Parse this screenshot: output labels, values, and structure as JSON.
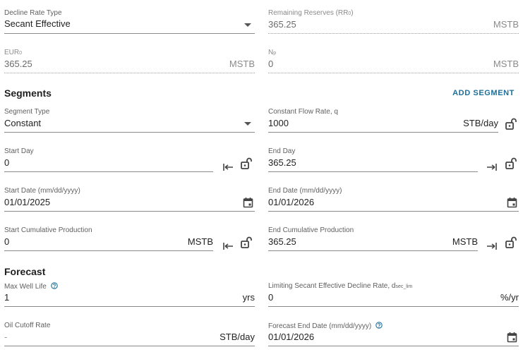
{
  "decline_rate_type": {
    "label": "Decline Rate Type",
    "value": "Secant Effective"
  },
  "remaining_reserves": {
    "label": "Remaining Reserves (RR",
    "label_sub": "0",
    "label_end": ")",
    "value": "365.25",
    "unit": "MSTB"
  },
  "eur": {
    "label": "EUR",
    "label_sub": "0",
    "value": "365.25",
    "unit": "MSTB"
  },
  "np": {
    "label": "N",
    "label_sub": "p",
    "value": "0",
    "unit": "MSTB"
  },
  "segments": {
    "heading": "Segments",
    "add_button": "ADD SEGMENT"
  },
  "segment_type": {
    "label": "Segment Type",
    "value": "Constant"
  },
  "constant_flow_rate": {
    "label": "Constant Flow Rate, q",
    "value": "1000",
    "unit": "STB/day"
  },
  "start_day": {
    "label": "Start Day",
    "value": "0"
  },
  "end_day": {
    "label": "End Day",
    "value": "365.25"
  },
  "start_date": {
    "label": "Start Date (mm/dd/yyyy)",
    "value": "01/01/2025"
  },
  "end_date": {
    "label": "End Date (mm/dd/yyyy)",
    "value": "01/01/2026"
  },
  "start_cum": {
    "label": "Start Cumulative Production",
    "value": "0",
    "unit": "MSTB"
  },
  "end_cum": {
    "label": "End Cumulative Production",
    "value": "365.25",
    "unit": "MSTB"
  },
  "forecast": {
    "heading": "Forecast"
  },
  "max_well_life": {
    "label": "Max Well Life",
    "value": "1",
    "unit": "yrs"
  },
  "limiting_decline": {
    "label": "Limiting Secant Effective Decline Rate, d",
    "label_sub": "sec_lim",
    "value": "0",
    "unit": "%/yr"
  },
  "oil_cutoff": {
    "label": "Oil Cutoff Rate",
    "placeholder": "-",
    "unit": "STB/day"
  },
  "forecast_end_date": {
    "label": "Forecast End Date (mm/dd/yyyy)",
    "value": "01/01/2026"
  },
  "colors": {
    "accent": "#1d6f97",
    "text": "#222222",
    "muted": "#6b6b6b"
  },
  "icons": [
    "chevron-down-icon",
    "lock-open-icon",
    "arrow-bar-left-icon",
    "arrow-bar-right-icon",
    "calendar-icon",
    "help-circle-icon"
  ]
}
